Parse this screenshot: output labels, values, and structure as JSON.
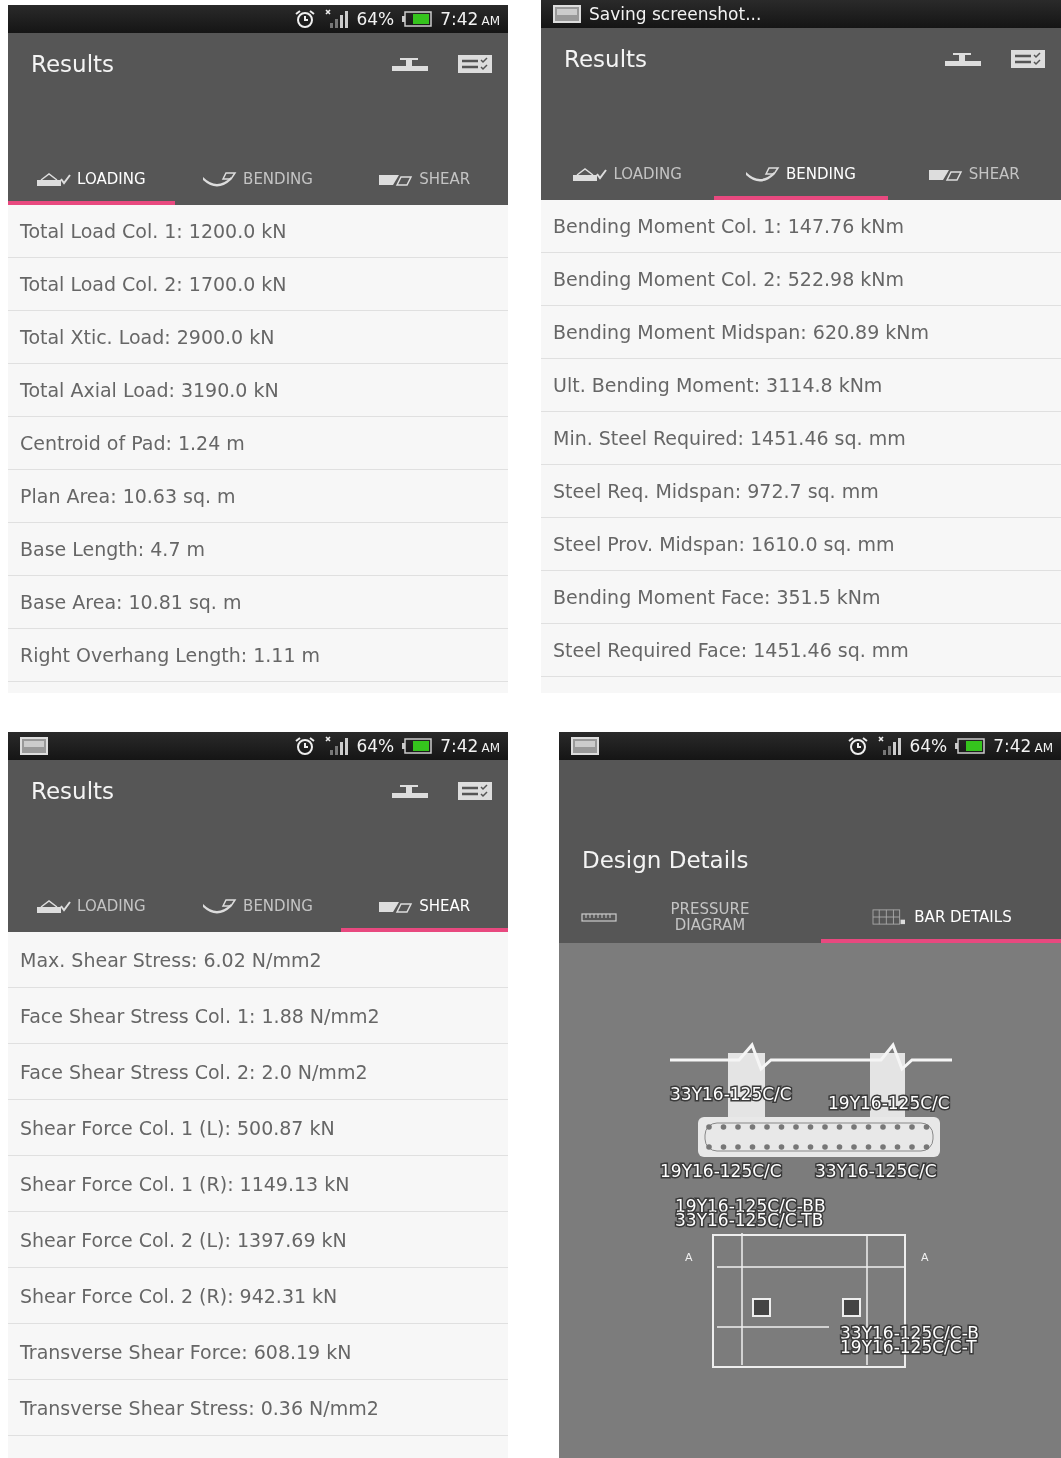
{
  "panels": [
    {
      "status_bar": {
        "kind": "system",
        "battery": "64%",
        "time": "7:42",
        "meridiem": "AM"
      },
      "header": {
        "kind": "results",
        "title": "Results",
        "tabs": [
          {
            "label": "LOADING",
            "selected": true
          },
          {
            "label": "BENDING",
            "selected": false
          },
          {
            "label": "SHEAR",
            "selected": false
          }
        ]
      },
      "content": {
        "kind": "list",
        "items": [
          "Total Load Col. 1: 1200.0 kN",
          "Total Load Col. 2: 1700.0 kN",
          "Total Xtic. Load: 2900.0 kN",
          "Total Axial Load: 3190.0 kN",
          "Centroid of Pad: 1.24 m",
          "Plan Area: 10.63 sq. m",
          "Base Length: 4.7 m",
          "Base Area: 10.81 sq. m",
          "Right Overhang Length: 1.11 m"
        ]
      }
    },
    {
      "status_bar": {
        "kind": "notice",
        "text": "Saving screenshot..."
      },
      "header": {
        "kind": "results",
        "title": "Results",
        "tabs": [
          {
            "label": "LOADING",
            "selected": false
          },
          {
            "label": "BENDING",
            "selected": true
          },
          {
            "label": "SHEAR",
            "selected": false
          }
        ]
      },
      "content": {
        "kind": "list",
        "items": [
          "Bending Moment Col. 1: 147.76 kNm",
          "Bending Moment Col. 2: 522.98 kNm",
          "Bending Moment Midspan: 620.89 kNm",
          "Ult. Bending Moment: 3114.8 kNm",
          "Min. Steel Required: 1451.46 sq. mm",
          "Steel Req. Midspan: 972.7 sq. mm",
          "Steel Prov. Midspan: 1610.0 sq. mm",
          "Bending Moment Face: 351.5 kNm",
          "Steel Required Face: 1451.46 sq. mm"
        ]
      }
    },
    {
      "status_bar": {
        "kind": "system",
        "screenshot_icon": true,
        "battery": "64%",
        "time": "7:42",
        "meridiem": "AM"
      },
      "header": {
        "kind": "results",
        "title": "Results",
        "tabs": [
          {
            "label": "LOADING",
            "selected": false
          },
          {
            "label": "BENDING",
            "selected": false
          },
          {
            "label": "SHEAR",
            "selected": true
          }
        ]
      },
      "content": {
        "kind": "list",
        "items": [
          "Max. Shear Stress: 6.02 N/mm2",
          "Face Shear Stress Col. 1: 1.88 N/mm2",
          "Face Shear Stress Col. 2: 2.0 N/mm2",
          "Shear Force Col. 1 (L): 500.87 kN",
          "Shear Force Col. 1 (R): 1149.13 kN",
          "Shear Force Col. 2 (L): 1397.69 kN",
          "Shear Force Col. 2 (R): 942.31 kN",
          "Transverse Shear Force: 608.19 kN",
          "Transverse Shear Stress: 0.36 N/mm2"
        ]
      }
    },
    {
      "status_bar": {
        "kind": "system",
        "screenshot_icon": true,
        "battery": "64%",
        "time": "7:42",
        "meridiem": "AM"
      },
      "header": {
        "kind": "design",
        "title": "Design Details",
        "tabs": [
          {
            "label": "PRESSURE DIAGRAM",
            "selected": false
          },
          {
            "label": "BAR DETAILS",
            "selected": true
          }
        ]
      },
      "content": {
        "kind": "diagram",
        "section_labels": [
          "33Y16-125C/C",
          "19Y16-125C/C",
          "19Y16-125C/C",
          "33Y16-125C/C"
        ],
        "plan_labels_top": [
          "19Y16-125C/C-BB",
          "33Y16-125C/C-TB"
        ],
        "plan_labels_bottom": [
          "33Y16-125C/C-B",
          "19Y16-125C/C-T"
        ],
        "section_marks": [
          "A",
          "A"
        ]
      }
    }
  ]
}
